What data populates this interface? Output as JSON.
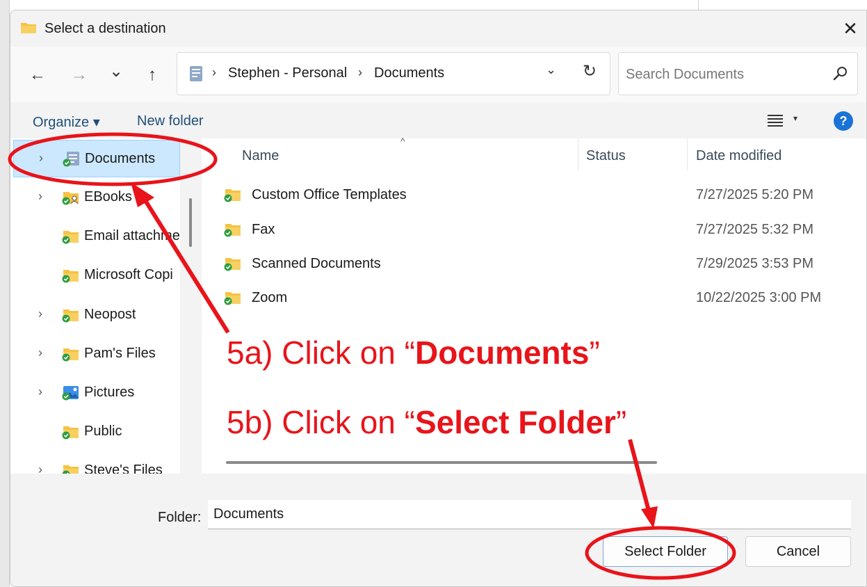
{
  "dialog": {
    "title": "Select a destination",
    "close_glyph": "✕"
  },
  "nav": {
    "back_glyph": "←",
    "forward_glyph": "→",
    "recent_glyph": "⌄",
    "up_glyph": "↑",
    "breadcrumb": [
      "Stephen - Personal",
      "Documents"
    ],
    "breadcrumb_sep": "›",
    "dropdown_glyph": "⌄",
    "refresh_glyph": "↻"
  },
  "search": {
    "placeholder": "Search Documents"
  },
  "toolbar": {
    "organize_label": "Organize ▾",
    "new_folder_label": "New folder",
    "view_dropdown_glyph": "▾",
    "help_glyph": "?"
  },
  "sidebar": {
    "items": [
      {
        "label": "Documents",
        "expandable": true,
        "selected": true,
        "icon": "documents-icon"
      },
      {
        "label": "EBooks",
        "expandable": true,
        "selected": false,
        "icon": "shared-folder-icon"
      },
      {
        "label": "Email attachme",
        "expandable": false,
        "selected": false,
        "icon": "folder-icon"
      },
      {
        "label": "Microsoft Copi",
        "expandable": false,
        "selected": false,
        "icon": "folder-icon"
      },
      {
        "label": "Neopost",
        "expandable": true,
        "selected": false,
        "icon": "folder-icon"
      },
      {
        "label": "Pam's Files",
        "expandable": true,
        "selected": false,
        "icon": "folder-icon"
      },
      {
        "label": "Pictures",
        "expandable": true,
        "selected": false,
        "icon": "pictures-icon"
      },
      {
        "label": "Public",
        "expandable": false,
        "selected": false,
        "icon": "folder-icon"
      },
      {
        "label": "Steve's Files",
        "expandable": true,
        "selected": false,
        "icon": "folder-icon"
      }
    ],
    "chevron_glyph": "›"
  },
  "files": {
    "columns": {
      "name": "Name",
      "status": "Status",
      "date": "Date modified"
    },
    "sort_glyph": "^",
    "rows": [
      {
        "name": "Custom Office Templates",
        "date": "7/27/2025 5:20 PM"
      },
      {
        "name": "Fax",
        "date": "7/27/2025 5:32 PM"
      },
      {
        "name": "Scanned Documents",
        "date": "7/29/2025 3:53 PM"
      },
      {
        "name": "Zoom",
        "date": "10/22/2025 3:00 PM"
      }
    ]
  },
  "footer": {
    "folder_label": "Folder:",
    "folder_value": "Documents",
    "select_label": "Select Folder",
    "cancel_label": "Cancel"
  },
  "annotations": {
    "step_a_prefix": "5a)  Click on “",
    "step_a_bold": "Documents",
    "step_a_suffix": "”",
    "step_b_prefix": "5b)  Click on “",
    "step_b_bold": "Select Folder",
    "step_b_suffix": "”",
    "color": "#e8141a"
  },
  "colors": {
    "selection": "#cce8ff",
    "accent": "#1a73d6",
    "folder": "#f5c242",
    "sync_ok": "#2e9e3f"
  }
}
